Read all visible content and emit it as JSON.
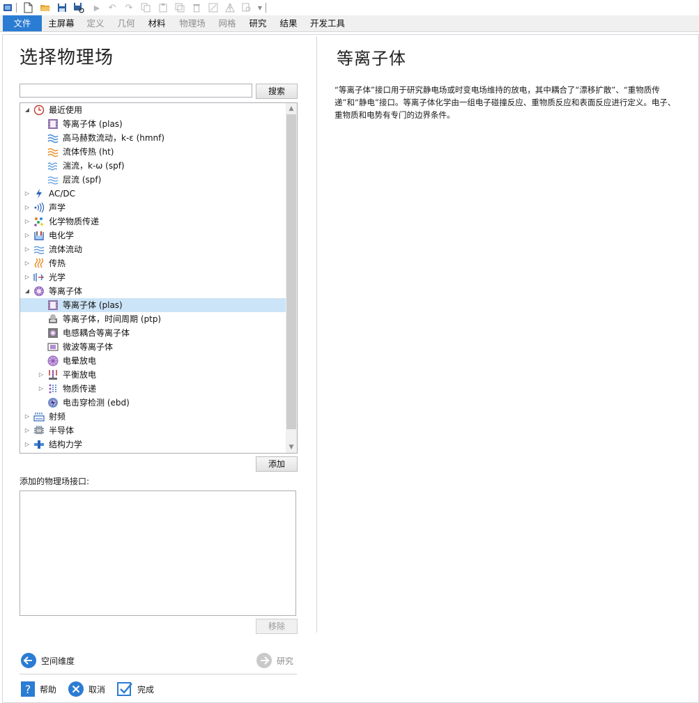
{
  "ribbon_tabs": [
    {
      "label": "文件",
      "state": "file"
    },
    {
      "label": "主屏幕",
      "state": "normal"
    },
    {
      "label": "定义",
      "state": "dim"
    },
    {
      "label": "几何",
      "state": "dim"
    },
    {
      "label": "材料",
      "state": "normal"
    },
    {
      "label": "物理场",
      "state": "dim"
    },
    {
      "label": "网格",
      "state": "dim"
    },
    {
      "label": "研究",
      "state": "normal"
    },
    {
      "label": "结果",
      "state": "normal"
    },
    {
      "label": "开发工具",
      "state": "normal"
    }
  ],
  "left": {
    "title": "选择物理场",
    "search": {
      "value": "",
      "button": "搜索"
    },
    "tree": [
      {
        "label": "最近使用",
        "level": 0,
        "expander": "expanded",
        "icon": "clock-icon",
        "selected": false
      },
      {
        "label": "等离子体 (plas)",
        "level": 1,
        "expander": "none",
        "icon": "plasma-icon",
        "selected": false
      },
      {
        "label": "高马赫数流动，k-ε (hmnf)",
        "level": 1,
        "expander": "none",
        "icon": "high-mach-flow-icon",
        "selected": false
      },
      {
        "label": "流体传热 (ht)",
        "level": 1,
        "expander": "none",
        "icon": "heat-transfer-fluids-icon",
        "selected": false
      },
      {
        "label": "湍流，k-ω (spf)",
        "level": 1,
        "expander": "none",
        "icon": "turbulent-flow-icon",
        "selected": false
      },
      {
        "label": "层流 (spf)",
        "level": 1,
        "expander": "none",
        "icon": "laminar-flow-icon",
        "selected": false
      },
      {
        "label": "AC/DC",
        "level": 0,
        "expander": "collapsed",
        "icon": "acdc-icon",
        "selected": false
      },
      {
        "label": "声学",
        "level": 0,
        "expander": "collapsed",
        "icon": "acoustics-icon",
        "selected": false
      },
      {
        "label": "化学物质传递",
        "level": 0,
        "expander": "collapsed",
        "icon": "chemical-transport-icon",
        "selected": false
      },
      {
        "label": "电化学",
        "level": 0,
        "expander": "collapsed",
        "icon": "electrochemistry-icon",
        "selected": false
      },
      {
        "label": "流体流动",
        "level": 0,
        "expander": "collapsed",
        "icon": "fluid-flow-icon",
        "selected": false
      },
      {
        "label": "传热",
        "level": 0,
        "expander": "collapsed",
        "icon": "heat-transfer-icon",
        "selected": false
      },
      {
        "label": "光学",
        "level": 0,
        "expander": "collapsed",
        "icon": "optics-icon",
        "selected": false
      },
      {
        "label": "等离子体",
        "level": 0,
        "expander": "expanded",
        "icon": "plasma-module-icon",
        "selected": false
      },
      {
        "label": "等离子体 (plas)",
        "level": 1,
        "expander": "none",
        "icon": "plasma-icon",
        "selected": true
      },
      {
        "label": "等离子体，时间周期 (ptp)",
        "level": 1,
        "expander": "none",
        "icon": "plasma-time-periodic-icon",
        "selected": false
      },
      {
        "label": "电感耦合等离子体",
        "level": 1,
        "expander": "none",
        "icon": "inductively-coupled-plasma-icon",
        "selected": false
      },
      {
        "label": "微波等离子体",
        "level": 1,
        "expander": "none",
        "icon": "microwave-plasma-icon",
        "selected": false
      },
      {
        "label": "电晕放电",
        "level": 1,
        "expander": "none",
        "icon": "corona-discharge-icon",
        "selected": false
      },
      {
        "label": "平衡放电",
        "level": 1,
        "expander": "collapsed",
        "icon": "equilibrium-discharge-icon",
        "selected": false
      },
      {
        "label": "物质传递",
        "level": 1,
        "expander": "collapsed",
        "icon": "species-transport-icon",
        "selected": false
      },
      {
        "label": "电击穿检测 (ebd)",
        "level": 1,
        "expander": "none",
        "icon": "electrical-breakdown-icon",
        "selected": false
      },
      {
        "label": "射频",
        "level": 0,
        "expander": "collapsed",
        "icon": "rf-icon",
        "selected": false
      },
      {
        "label": "半导体",
        "level": 0,
        "expander": "collapsed",
        "icon": "semiconductor-icon",
        "selected": false
      },
      {
        "label": "结构力学",
        "level": 0,
        "expander": "collapsed",
        "icon": "structural-mechanics-icon",
        "selected": false
      }
    ],
    "add_button": "添加",
    "added_label": "添加的物理场接口:",
    "added_items": [],
    "remove_button": "移除",
    "nav_back": "空间维度",
    "nav_forward": "研究",
    "help": "帮助",
    "cancel": "取消",
    "done": "完成"
  },
  "right": {
    "title": "等离子体",
    "description": "“等离子体”接口用于研究静电场或时变电场维持的放电，其中耦合了“漂移扩散”、“重物质传递”和“静电”接口。等离子体化学由一组电子碰撞反应、重物质反应和表面反应进行定义。电子、重物质和电势有专门的边界条件。"
  },
  "colors": {
    "accent": "#2b7cd3",
    "selection": "#cce4f7"
  }
}
